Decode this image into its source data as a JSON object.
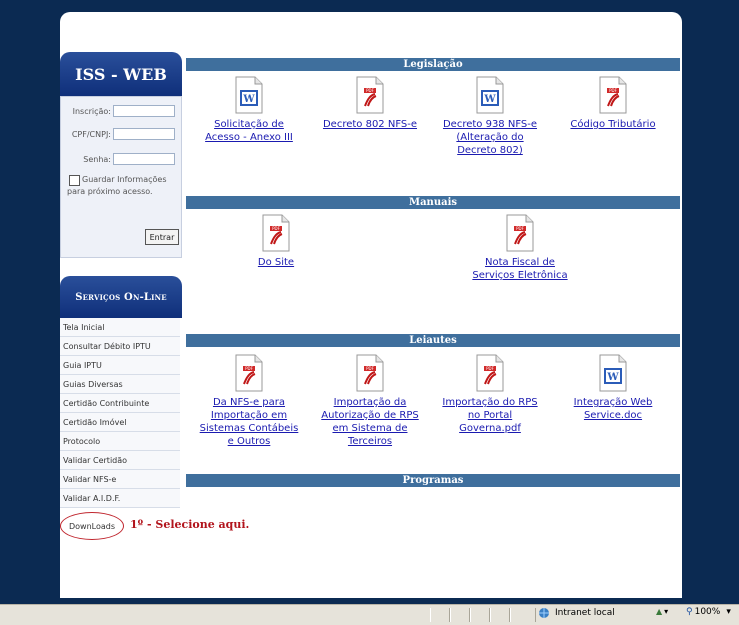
{
  "login": {
    "title": "ISS - WEB",
    "inscricao_label": "Inscrição:",
    "cpf_label": "CPF/CNPJ:",
    "senha_label": "Senha:",
    "remember_label_1": "Guardar Informações",
    "remember_label_2": "para próximo acesso.",
    "submit_label": "Entrar"
  },
  "services": {
    "title": "Serviços On-Line",
    "items": [
      "Tela Inicial",
      "Consultar Débito IPTU",
      "Guia IPTU",
      "Guias Diversas",
      "Certidão Contribuinte",
      "Certidão Imóvel",
      "Protocolo",
      "Validar Certidão",
      "Validar NFS-e",
      "Validar A.I.D.F.",
      "DownLoads"
    ],
    "note": "1º - Selecione aqui."
  },
  "sections": {
    "legislacao": "Legislação",
    "manuais": "Manuais",
    "leiautes": "Leiautes",
    "programas": "Programas"
  },
  "legislacao_docs": [
    {
      "type": "word",
      "line1": "Solicitação de",
      "line2": "Acesso - Anexo III",
      "line3": "",
      "line4": ""
    },
    {
      "type": "pdf",
      "line1": "Decreto 802 NFS-e",
      "line2": "",
      "line3": "",
      "line4": ""
    },
    {
      "type": "word",
      "line1": "Decreto 938 NFS-e",
      "line2": "(Alteração do",
      "line3": "Decreto 802)",
      "line4": ""
    },
    {
      "type": "pdf",
      "line1": "Código Tributário",
      "line2": "",
      "line3": "",
      "line4": ""
    }
  ],
  "manuais_docs": [
    {
      "type": "pdf",
      "line1": "Do Site",
      "line2": "",
      "line3": "",
      "line4": ""
    },
    {
      "type": "pdf",
      "line1": "Nota Fiscal de",
      "line2": "Serviços Eletrônica",
      "line3": "",
      "line4": ""
    }
  ],
  "leiautes_docs": [
    {
      "type": "pdf",
      "line1": "Da NFS-e para",
      "line2": "Importação em",
      "line3": "Sistemas Contábeis",
      "line4": "e Outros"
    },
    {
      "type": "pdf",
      "line1": "Importação da",
      "line2": "Autorização de RPS",
      "line3": "em Sistema de",
      "line4": "Terceiros"
    },
    {
      "type": "pdf",
      "line1": "Importação do RPS",
      "line2": "no Portal",
      "line3": "Governa.pdf",
      "line4": ""
    },
    {
      "type": "word",
      "line1": "Integração Web",
      "line2": "Service.doc",
      "line3": "",
      "line4": ""
    }
  ],
  "statusbar": {
    "zone": "Intranet local",
    "zoom": "100%"
  },
  "colors": {
    "section_bar": "#3f6f9d",
    "panel_header": "#1a3d8a",
    "link": "#1a1ab0",
    "note": "#b2141c"
  }
}
